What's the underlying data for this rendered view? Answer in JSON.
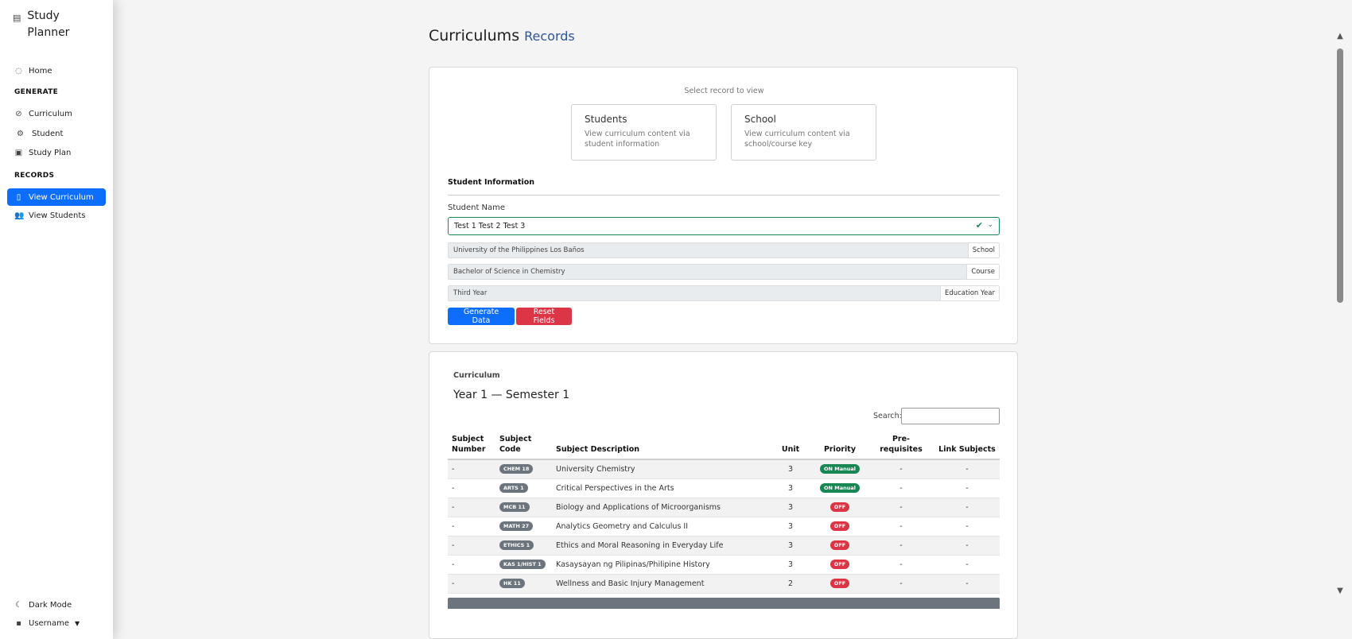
{
  "sidebar": {
    "brand": "Study Planner",
    "home": "Home",
    "generate_label": "GENERATE",
    "curriculum": "Curriculum",
    "student": "Student",
    "study_plan": "Study Plan",
    "records_label": "RECORDS",
    "view_curriculum": "View Curriculum",
    "view_students": "View Students",
    "dark_mode": "Dark Mode",
    "username": "Username"
  },
  "page": {
    "title": "Curriculums",
    "subtitle": "Records"
  },
  "record_select": {
    "hint": "Select record to view",
    "students": {
      "title": "Students",
      "desc": "View curriculum content via student information"
    },
    "school": {
      "title": "School",
      "desc": "View curriculum content via school/course key"
    }
  },
  "student_info": {
    "title": "Student Information",
    "name_label": "Student Name",
    "name_value": "Test 1 Test 2 Test 3",
    "school_value": "University of the Philippines Los Baños",
    "school_suffix": "School",
    "course_value": "Bachelor of Science in Chemistry",
    "course_suffix": "Course",
    "year_value": "Third Year",
    "year_suffix": "Education Year",
    "generate_button": "Generate Data",
    "reset_button": "Reset Fields"
  },
  "curriculum": {
    "label": "Curriculum",
    "semester_title": "Year 1 — Semester 1",
    "search_label": "Search:",
    "columns": {
      "number": "Subject Number",
      "code": "Subject Code",
      "description": "Subject Description",
      "unit": "Unit",
      "priority": "Priority",
      "prereq": "Pre-requisites",
      "link": "Link Subjects"
    },
    "rows": [
      {
        "number": "-",
        "code": "CHEM 18",
        "description": "University Chemistry",
        "unit": "3",
        "priority": "ON Manual",
        "prereq": "-",
        "link": "-"
      },
      {
        "number": "-",
        "code": "ARTS 1",
        "description": "Critical Perspectives in the Arts",
        "unit": "3",
        "priority": "ON Manual",
        "prereq": "-",
        "link": "-"
      },
      {
        "number": "-",
        "code": "MCB 11",
        "description": "Biology and Applications of Microorganisms",
        "unit": "3",
        "priority": "OFF",
        "prereq": "-",
        "link": "-"
      },
      {
        "number": "-",
        "code": "MATH 27",
        "description": "Analytics Geometry and Calculus II",
        "unit": "3",
        "priority": "OFF",
        "prereq": "-",
        "link": "-"
      },
      {
        "number": "-",
        "code": "ETHICS 1",
        "description": "Ethics and Moral Reasoning in Everyday Life",
        "unit": "3",
        "priority": "OFF",
        "prereq": "-",
        "link": "-"
      },
      {
        "number": "-",
        "code": "KAS 1/HIST 1",
        "description": "Kasaysayan ng Pilipinas/Philipine History",
        "unit": "3",
        "priority": "OFF",
        "prereq": "-",
        "link": "-"
      },
      {
        "number": "-",
        "code": "HK 11",
        "description": "Wellness and Basic Injury Management",
        "unit": "2",
        "priority": "OFF",
        "prereq": "-",
        "link": "-"
      }
    ]
  },
  "colors": {
    "primary": "#0d6efd",
    "danger": "#dc3545",
    "success": "#198754",
    "badge_gray": "#6c757d"
  },
  "icons": {
    "brand": "book-icon",
    "home": "home-icon",
    "curriculum": "check-circle-icon",
    "student": "user-gear-icon",
    "study_plan": "calendar-icon",
    "view_curriculum": "document-icon",
    "view_students": "users-icon",
    "dark_mode": "moon-icon",
    "username": "user-square-icon"
  }
}
